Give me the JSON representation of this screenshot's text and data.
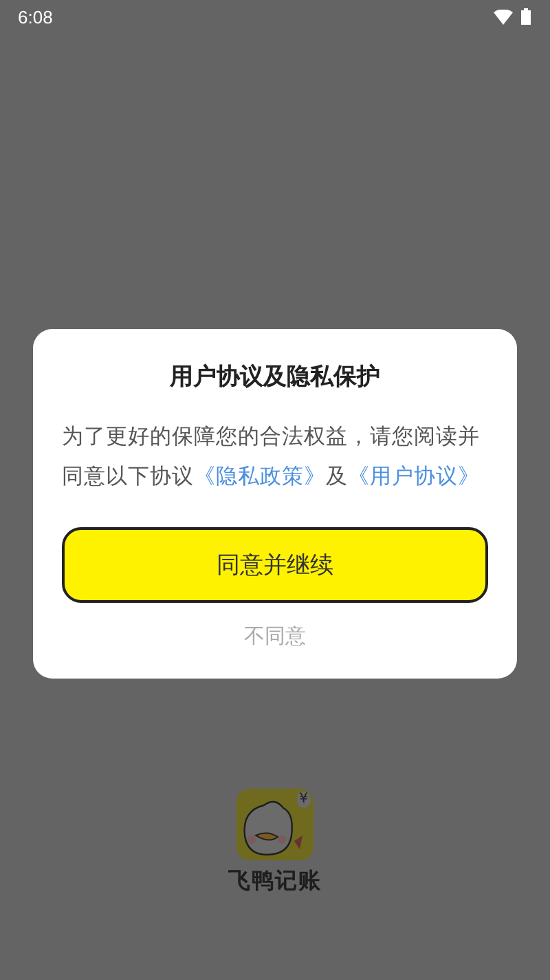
{
  "status_bar": {
    "time": "6:08"
  },
  "dialog": {
    "title": "用户协议及隐私保护",
    "message": [
      {
        "kind": "text",
        "text": "为了更好的保障您的合法权益，请您阅读并同意以下协议"
      },
      {
        "kind": "link",
        "text": "《隐私政策》"
      },
      {
        "kind": "text",
        "text": "及"
      },
      {
        "kind": "link",
        "text": "《用户协议》"
      }
    ],
    "buttons": [
      {
        "kind": "primary",
        "label": "同意并继续"
      },
      {
        "kind": "plain",
        "label": "不同意"
      }
    ]
  },
  "app": {
    "logo_badge": "¥",
    "name": "飞鸭记账"
  }
}
